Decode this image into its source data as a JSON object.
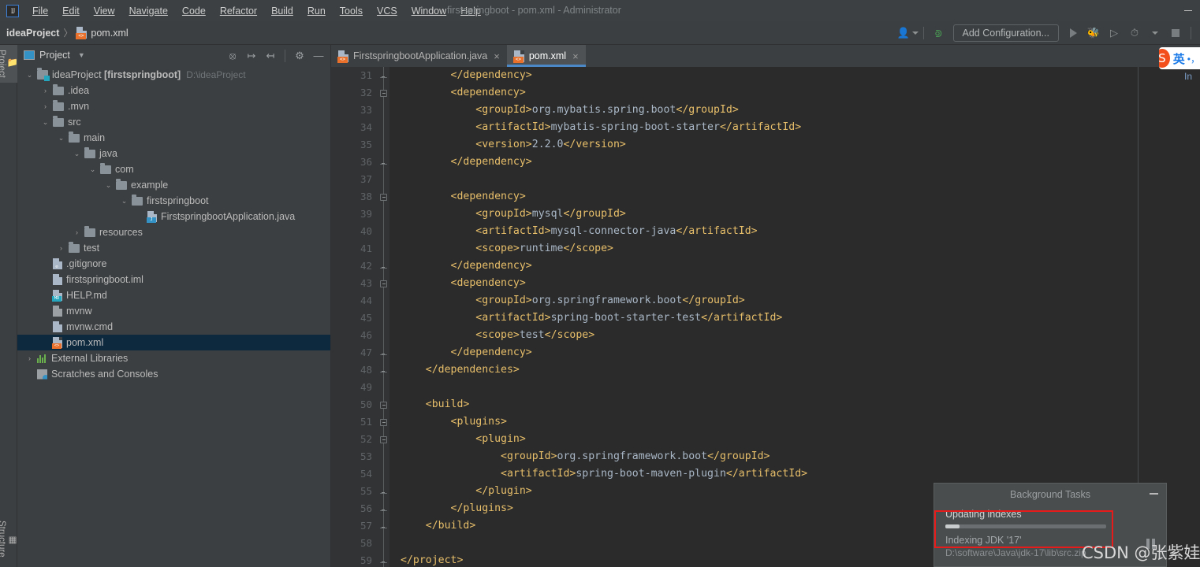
{
  "window": {
    "title": "firstspringboot - pom.xml - Administrator",
    "logo": "intellij-idea-logo",
    "minimize_label": "—"
  },
  "menubar": {
    "items": [
      {
        "label": "File"
      },
      {
        "label": "Edit"
      },
      {
        "label": "View"
      },
      {
        "label": "Navigate"
      },
      {
        "label": "Code"
      },
      {
        "label": "Refactor"
      },
      {
        "label": "Build"
      },
      {
        "label": "Run"
      },
      {
        "label": "Tools"
      },
      {
        "label": "VCS"
      },
      {
        "label": "Window"
      },
      {
        "label": "Help"
      }
    ]
  },
  "breadcrumb": {
    "project": "ideaProject",
    "separator": "〉",
    "file": "pom.xml"
  },
  "toolbar": {
    "add_configuration": "Add Configuration...",
    "icons": [
      {
        "name": "user-switch-icon"
      },
      {
        "name": "build-hammer-icon"
      },
      {
        "name": "run-icon"
      },
      {
        "name": "debug-icon"
      },
      {
        "name": "run-with-coverage-icon"
      },
      {
        "name": "profiler-icon"
      },
      {
        "name": "stop-icon"
      }
    ]
  },
  "left_strip": {
    "tabs": [
      {
        "label": "Project",
        "active": true
      },
      {
        "label": "Structure",
        "active": false
      }
    ]
  },
  "project_panel": {
    "title": "Project",
    "dropdown": "▼",
    "tools": [
      {
        "name": "select-opened-file-icon"
      },
      {
        "name": "expand-all-icon"
      },
      {
        "name": "collapse-all-icon"
      },
      {
        "name": "settings-gear-icon"
      },
      {
        "name": "hide-panel-icon"
      }
    ],
    "tree": [
      {
        "indent": 0,
        "arrow": "⌄",
        "icon": "module",
        "name": "ideaProject",
        "bold_name": "[firstspringboot]",
        "hint": "D:\\ideaProject",
        "selected": false
      },
      {
        "indent": 1,
        "arrow": "›",
        "icon": "folder",
        "name": ".idea",
        "selected": false
      },
      {
        "indent": 1,
        "arrow": "›",
        "icon": "folder",
        "name": ".mvn",
        "selected": false
      },
      {
        "indent": 1,
        "arrow": "⌄",
        "icon": "folder",
        "name": "src",
        "selected": false
      },
      {
        "indent": 2,
        "arrow": "⌄",
        "icon": "folder",
        "name": "main",
        "selected": false
      },
      {
        "indent": 3,
        "arrow": "⌄",
        "icon": "folder",
        "name": "java",
        "selected": false
      },
      {
        "indent": 4,
        "arrow": "⌄",
        "icon": "folder",
        "name": "com",
        "selected": false
      },
      {
        "indent": 5,
        "arrow": "⌄",
        "icon": "folder",
        "name": "example",
        "selected": false
      },
      {
        "indent": 6,
        "arrow": "⌄",
        "icon": "folder",
        "name": "firstspringboot",
        "selected": false
      },
      {
        "indent": 7,
        "arrow": "",
        "icon": "java-file",
        "name": "FirstspringbootApplication.java",
        "selected": false
      },
      {
        "indent": 3,
        "arrow": "›",
        "icon": "folder",
        "name": "resources",
        "selected": false
      },
      {
        "indent": 2,
        "arrow": "›",
        "icon": "folder",
        "name": "test",
        "selected": false
      },
      {
        "indent": 1,
        "arrow": "",
        "icon": "gitignore-file",
        "name": ".gitignore",
        "selected": false
      },
      {
        "indent": 1,
        "arrow": "",
        "icon": "iml-file",
        "name": "firstspringboot.iml",
        "selected": false
      },
      {
        "indent": 1,
        "arrow": "",
        "icon": "md-file",
        "name": "HELP.md",
        "selected": false
      },
      {
        "indent": 1,
        "arrow": "",
        "icon": "script-file",
        "name": "mvnw",
        "selected": false
      },
      {
        "indent": 1,
        "arrow": "",
        "icon": "cmd-file",
        "name": "mvnw.cmd",
        "selected": false
      },
      {
        "indent": 1,
        "arrow": "",
        "icon": "xml-file",
        "name": "pom.xml",
        "selected": true
      },
      {
        "indent": 0,
        "arrow": "›",
        "icon": "library",
        "name": "External Libraries",
        "selected": false
      },
      {
        "indent": 0,
        "arrow": "",
        "icon": "scratches",
        "name": "Scratches and Consoles",
        "selected": false
      }
    ]
  },
  "editor": {
    "tabs": [
      {
        "label": "FirstspringbootApplication.java",
        "icon": "java-file",
        "active": false,
        "close": "×"
      },
      {
        "label": "pom.xml",
        "icon": "xml-file",
        "active": true,
        "close": "×"
      }
    ],
    "first_line_number": 31,
    "lines": [
      {
        "n": 31,
        "fold": "end",
        "indent": 8,
        "html": "<span class='t-tag'>&lt;/dependency&gt;</span>"
      },
      {
        "n": 32,
        "fold": "start",
        "indent": 8,
        "html": "<span class='t-tag'>&lt;dependency&gt;</span>"
      },
      {
        "n": 33,
        "fold": "",
        "indent": 12,
        "html": "<span class='t-tag'>&lt;groupId&gt;</span><span class='t-txt'>org.mybatis.spring.boot</span><span class='t-tag'>&lt;/groupId&gt;</span>"
      },
      {
        "n": 34,
        "fold": "",
        "indent": 12,
        "html": "<span class='t-tag'>&lt;artifactId&gt;</span><span class='t-txt'>mybatis-spring-boot-starter</span><span class='t-tag'>&lt;/artifactId&gt;</span>"
      },
      {
        "n": 35,
        "fold": "",
        "indent": 12,
        "html": "<span class='t-tag'>&lt;version&gt;</span><span class='t-txt'>2.2.0</span><span class='t-tag'>&lt;/version&gt;</span>"
      },
      {
        "n": 36,
        "fold": "end",
        "indent": 8,
        "html": "<span class='t-tag'>&lt;/dependency&gt;</span>"
      },
      {
        "n": 37,
        "fold": "",
        "indent": 0,
        "html": ""
      },
      {
        "n": 38,
        "fold": "start",
        "indent": 8,
        "html": "<span class='t-tag'>&lt;dependency&gt;</span>"
      },
      {
        "n": 39,
        "fold": "",
        "indent": 12,
        "html": "<span class='t-tag'>&lt;groupId&gt;</span><span class='t-txt'>mysql</span><span class='t-tag'>&lt;/groupId&gt;</span>"
      },
      {
        "n": 40,
        "fold": "",
        "indent": 12,
        "html": "<span class='t-tag'>&lt;artifactId&gt;</span><span class='t-txt'>mysql-connector-java</span><span class='t-tag'>&lt;/artifactId&gt;</span>"
      },
      {
        "n": 41,
        "fold": "",
        "indent": 12,
        "html": "<span class='t-tag'>&lt;scope&gt;</span><span class='t-txt'>runtime</span><span class='t-tag'>&lt;/scope&gt;</span>"
      },
      {
        "n": 42,
        "fold": "end",
        "indent": 8,
        "html": "<span class='t-tag'>&lt;/dependency&gt;</span>"
      },
      {
        "n": 43,
        "fold": "start",
        "indent": 8,
        "html": "<span class='t-tag'>&lt;dependency&gt;</span>"
      },
      {
        "n": 44,
        "fold": "",
        "indent": 12,
        "html": "<span class='t-tag'>&lt;groupId&gt;</span><span class='t-txt'>org.springframework.boot</span><span class='t-tag'>&lt;/groupId&gt;</span>"
      },
      {
        "n": 45,
        "fold": "",
        "indent": 12,
        "html": "<span class='t-tag'>&lt;artifactId&gt;</span><span class='t-txt'>spring-boot-starter-test</span><span class='t-tag'>&lt;/artifactId&gt;</span>"
      },
      {
        "n": 46,
        "fold": "",
        "indent": 12,
        "html": "<span class='t-tag'>&lt;scope&gt;</span><span class='t-txt'>test</span><span class='t-tag'>&lt;/scope&gt;</span>"
      },
      {
        "n": 47,
        "fold": "end",
        "indent": 8,
        "html": "<span class='t-tag'>&lt;/dependency&gt;</span>"
      },
      {
        "n": 48,
        "fold": "end",
        "indent": 4,
        "html": "<span class='t-tag'>&lt;/dependencies&gt;</span>"
      },
      {
        "n": 49,
        "fold": "",
        "indent": 0,
        "html": ""
      },
      {
        "n": 50,
        "fold": "start",
        "indent": 4,
        "html": "<span class='t-tag'>&lt;build&gt;</span>"
      },
      {
        "n": 51,
        "fold": "start",
        "indent": 8,
        "html": "<span class='t-tag'>&lt;plugins&gt;</span>"
      },
      {
        "n": 52,
        "fold": "start",
        "indent": 12,
        "html": "<span class='t-tag'>&lt;plugin&gt;</span>"
      },
      {
        "n": 53,
        "fold": "",
        "indent": 16,
        "html": "<span class='t-tag'>&lt;groupId&gt;</span><span class='t-txt'>org.springframework.boot</span><span class='t-tag'>&lt;/groupId&gt;</span>"
      },
      {
        "n": 54,
        "fold": "",
        "indent": 16,
        "html": "<span class='t-tag'>&lt;artifactId&gt;</span><span class='t-txt'>spring-boot-maven-plugin</span><span class='t-tag'>&lt;/artifactId&gt;</span>"
      },
      {
        "n": 55,
        "fold": "end",
        "indent": 12,
        "html": "<span class='t-tag'>&lt;/plugin&gt;</span>"
      },
      {
        "n": 56,
        "fold": "end",
        "indent": 8,
        "html": "<span class='t-tag'>&lt;/plugins&gt;</span>"
      },
      {
        "n": 57,
        "fold": "end",
        "indent": 4,
        "html": "<span class='t-tag'>&lt;/build&gt;</span>"
      },
      {
        "n": 58,
        "fold": "",
        "indent": 0,
        "html": ""
      },
      {
        "n": 59,
        "fold": "end",
        "indent": 0,
        "html": "<span class='t-tag'>&lt;/project&gt;</span>"
      }
    ]
  },
  "background_tasks": {
    "title": "Background Tasks",
    "minimize": "—",
    "task_name": "Updating indexes",
    "progress_percent": 9,
    "sub_text": "Indexing JDK '17'",
    "sub_text_2": "D:\\software\\Java\\jdk-17\\lib\\src.zip",
    "pause_icon": "pause-icon"
  },
  "annotations": {
    "highlight_color": "#e81b1b",
    "watermark": "CSDN @张紫娃"
  },
  "ime": {
    "logo": "S",
    "mode": "英",
    "punctuation": "•，",
    "hint": "In"
  }
}
